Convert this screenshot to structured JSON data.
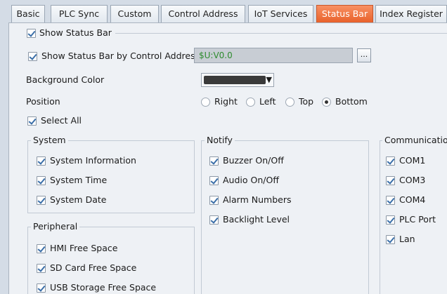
{
  "tabs": [
    {
      "label": "Basic",
      "active": false
    },
    {
      "label": "PLC Sync",
      "active": false
    },
    {
      "label": "Custom",
      "active": false
    },
    {
      "label": "Control Address",
      "active": false
    },
    {
      "label": "IoT Services",
      "active": false
    },
    {
      "label": "Status Bar",
      "active": true
    },
    {
      "label": "Index Register",
      "active": false
    }
  ],
  "show_status_bar": {
    "label": "Show Status Bar",
    "checked": true
  },
  "by_control_address": {
    "label": "Show Status Bar by Control Address",
    "checked": true,
    "value": "$U:V0.0",
    "browse_label": "..."
  },
  "background_color": {
    "label": "Background Color",
    "value": "#3a3a3a"
  },
  "position": {
    "label": "Position",
    "options": [
      "Right",
      "Left",
      "Top",
      "Bottom"
    ],
    "selected": "Bottom"
  },
  "select_all": {
    "label": "Select All",
    "checked": true
  },
  "groups": {
    "system": {
      "title": "System",
      "items": [
        "System Information",
        "System Time",
        "System Date"
      ]
    },
    "peripheral": {
      "title": "Peripheral",
      "items": [
        "HMI Free Space",
        "SD Card Free Space",
        "USB Storage Free Space"
      ]
    },
    "notify": {
      "title": "Notify",
      "items": [
        "Buzzer On/Off",
        "Audio On/Off",
        "Alarm Numbers",
        "Backlight Level"
      ]
    },
    "communication": {
      "title": "Communicatio",
      "items": [
        "COM1",
        "COM3",
        "COM4",
        "PLC Port",
        "Lan"
      ]
    }
  },
  "colors": {
    "active_tab": "#f0733a",
    "panel": "#eef1f5",
    "address_text": "#2e8b2e"
  }
}
